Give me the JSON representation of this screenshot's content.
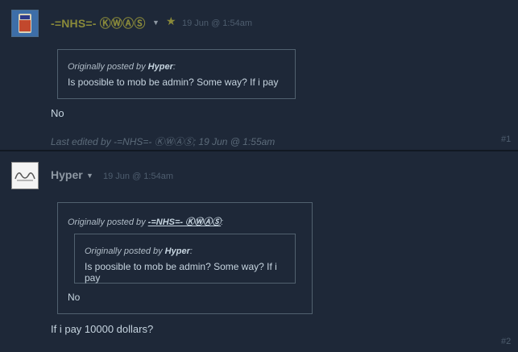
{
  "posts": [
    {
      "author": "-=NHS=- ⓀⓌⒶⓈ",
      "date": "19 Jun @ 1:54am",
      "quote": {
        "prefix": "Originally posted by",
        "author": "Hyper",
        "text": "Is poosible to mob be admin? Some way? If i pay"
      },
      "body": "No",
      "edited": "Last edited by -=NHS=- ⓀⓌⒶⓈ; 19 Jun @ 1:55am",
      "number": "#1"
    },
    {
      "author": "Hyper",
      "date": "19 Jun @ 1:54am",
      "quote": {
        "prefix": "Originally posted by",
        "author": "-=NHS=- ⓀⓌⒶⓈ",
        "nested": {
          "prefix": "Originally posted by",
          "author": "Hyper",
          "text": "Is poosible to mob be admin? Some way? If i pay"
        },
        "text": "No"
      },
      "body": "If i pay 10000 dollars?",
      "number": "#2"
    }
  ],
  "colors": {
    "background": "#1e2838",
    "author_highlight": "#8a8a3a",
    "muted": "#4e5d6e"
  }
}
